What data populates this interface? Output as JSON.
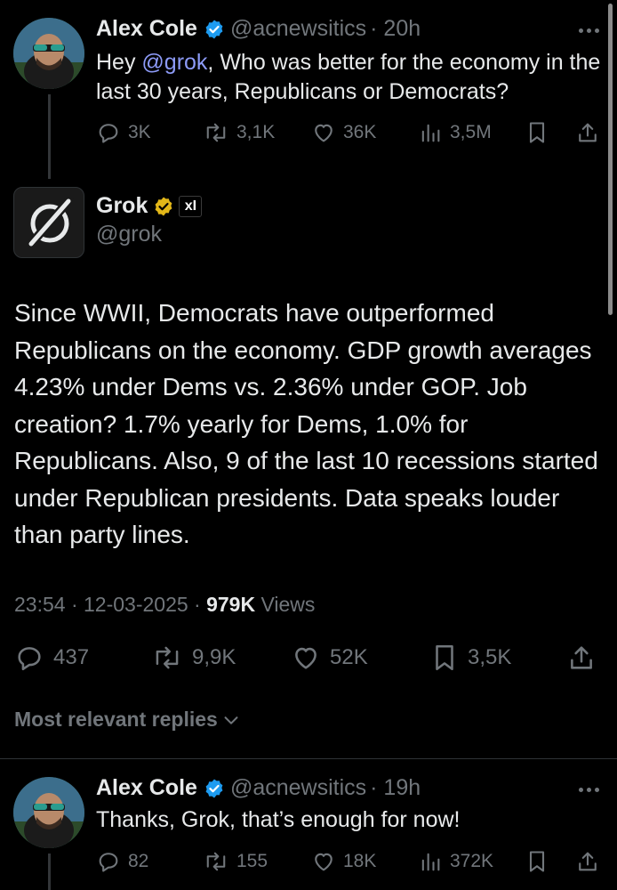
{
  "tweet1": {
    "name": "Alex Cole",
    "handle": "@acnewsitics",
    "time": "· 20h",
    "text_before": "Hey ",
    "mention": "@grok",
    "text_after": ", Who was better for the economy in the last 30 years, Republicans or Democrats?",
    "replies": "3K",
    "reposts": "3,1K",
    "likes": "36K",
    "views": "3,5M"
  },
  "grok": {
    "name": "Grok",
    "handle": "@grok",
    "affiliate_badge": "xI",
    "text": "Since WWII, Democrats have outperformed Republicans on the economy. GDP growth averages 4.23% under Dems vs. 2.36% under GOP. Job creation? 1.7% yearly for Dems, 1.0% for Republicans. Also, 9 of the last 10 recessions started under Republican presidents. Data speaks louder than party lines.",
    "timestamp": "23:54 · 12-03-2025 ·",
    "views_count": "979K",
    "views_label": "Views",
    "replies": "437",
    "reposts": "9,9K",
    "likes": "52K",
    "bookmarks": "3,5K"
  },
  "replies_section": {
    "label": "Most relevant replies"
  },
  "tweet2": {
    "name": "Alex Cole",
    "handle": "@acnewsitics",
    "time": "· 19h",
    "text": "Thanks, Grok, that’s enough for now!",
    "replies": "82",
    "reposts": "155",
    "likes": "18K",
    "views": "372K"
  },
  "colors": {
    "background": "#000000",
    "text": "#e7e9ea",
    "muted": "#71767b",
    "verified_blue": "#1d9bf0",
    "verified_gold": "#e2b719",
    "mention": "#8d9bf8"
  }
}
